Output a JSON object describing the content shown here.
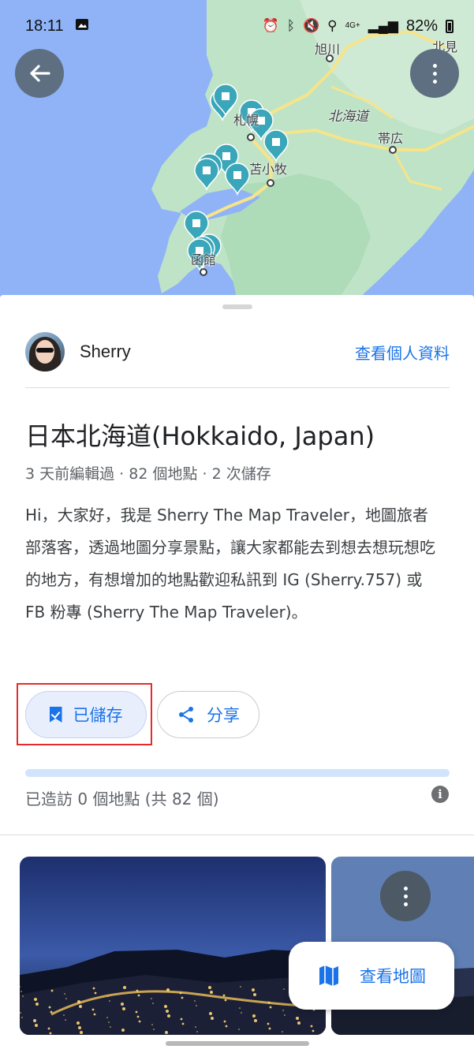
{
  "status_bar": {
    "time": "18:11",
    "network": "4G+",
    "battery": "82%",
    "icons": [
      "image-icon",
      "alarm-icon",
      "bluetooth-icon",
      "mute-icon",
      "location-icon",
      "signal-icon",
      "battery-icon"
    ]
  },
  "map": {
    "labels": [
      "旭川",
      "北見",
      "札幌",
      "北海道",
      "帯広",
      "苫小牧",
      "函館"
    ],
    "pin_count": 13,
    "colors": {
      "water": "#8fb3f6",
      "land": "#bfe3c7",
      "road": "#f6e48a",
      "pin": "#3aa6b9"
    }
  },
  "profile": {
    "name": "Sherry",
    "view_profile": "查看個人資料"
  },
  "list": {
    "title": "日本北海道(Hokkaido, Japan)",
    "meta": "3 天前編輯過 · 82 個地點 · 2 次儲存",
    "description": "Hi，大家好，我是 Sherry The Map Traveler，地圖旅者部落客，透過地圖分享景點，讓大家都能去到想去想玩想吃的地方，有想增加的地點歡迎私訊到 IG (Sherry.757) 或 FB 粉專 (Sherry The Map Traveler)。"
  },
  "actions": {
    "saved_label": "已儲存",
    "share_label": "分享"
  },
  "progress": {
    "visited_text": "已造訪 0 個地點 (共 82 個)",
    "visited": 0,
    "total": 82
  },
  "fab": {
    "view_map_label": "查看地圖"
  },
  "accent_color": "#1a73e8"
}
